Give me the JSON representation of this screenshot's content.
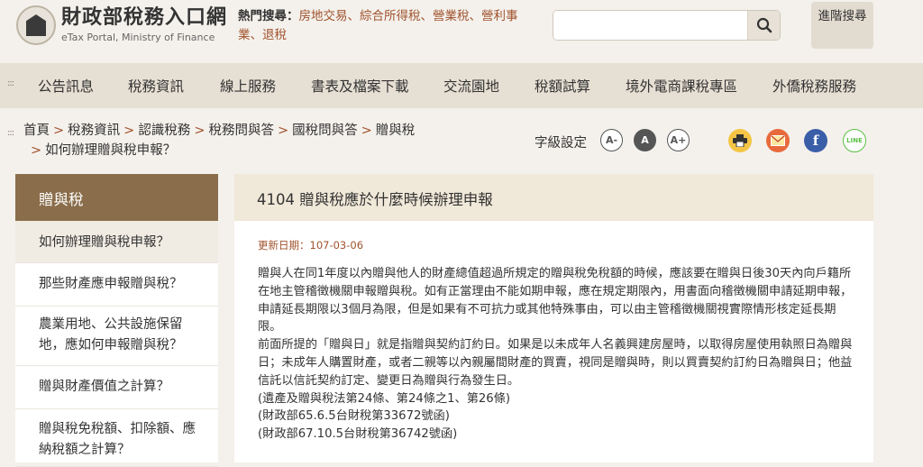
{
  "header": {
    "logo_cn": "財政部稅務入口網",
    "logo_en": "eTax Portal, Ministry of Finance",
    "hot_label": "熱門搜尋：",
    "hot_links": [
      "房地交易",
      "綜合所得稅",
      "營業稅",
      "營利事業",
      "退稅"
    ],
    "search_placeholder": "",
    "advanced_search_label": "進階搜尋"
  },
  "nav": {
    "items": [
      "公告訊息",
      "稅務資訊",
      "線上服務",
      "書表及檔案下載",
      "交流園地",
      "稅額試算",
      "境外電商課稅專區",
      "外僑稅務服務"
    ]
  },
  "breadcrumb": {
    "items": [
      "首頁",
      "稅務資訊",
      "認識稅務",
      "稅務問與答",
      "國稅問與答",
      "贈與稅"
    ],
    "current": "如何辦理贈與稅申報？"
  },
  "font_size": {
    "label": "字級設定",
    "small": "A-",
    "medium": "A",
    "large": "A+"
  },
  "share": {
    "facebook_glyph": "f",
    "line_glyph": "LINE"
  },
  "sidebar": {
    "title": "贈與稅",
    "items": [
      {
        "label": "如何辦理贈與稅申報？",
        "active": true
      },
      {
        "label": "那些財產應申報贈與稅？",
        "active": false
      },
      {
        "label": "農業用地、公共設施保留地，應如何申報贈與稅？",
        "active": false
      },
      {
        "label": "贈與財產價值之計算？",
        "active": false
      },
      {
        "label": "贈與稅免稅額、扣除額、應納稅額之計算？",
        "active": false
      }
    ]
  },
  "article": {
    "title": "4104 贈與稅應於什麼時候辦理申報",
    "update_date": "更新日期：107-03-06",
    "paragraphs": [
      "贈與人在同1年度以內贈與他人的財產總值超過所規定的贈與稅免稅額的時候，應該要在贈與日後30天內向戶籍所在地主管稽徵機關申報贈與稅。如有正當理由不能如期申報，應在規定期限內，用書面向稽徵機關申請延期申報，申請延長期限以3個月為限，但是如果有不可抗力或其他特殊事由，可以由主管稽徵機關視實際情形核定延長期限。",
      "前面所提的「贈與日」就是指贈與契約訂約日。如果是以未成年人名義興建房屋時，以取得房屋使用執照日為贈與日；未成年人購置財產，或者二親等以內親屬間財產的買賣，視同是贈與時，則以買賣契約訂約日為贈與日；他益信託以信託契約訂定、變更日為贈與行為發生日。",
      "(遺產及贈與稅法第24條、第24條之1、第26條)",
      "(財政部65.6.5台財稅第33672號函)",
      "(財政部67.10.5台財稅第36742號函)"
    ]
  },
  "colors": {
    "accent": "#a0522d",
    "sidebar_header": "#8a6d4a",
    "nav_bg": "#e6dfd3",
    "page_bg": "#f4f1ec"
  }
}
